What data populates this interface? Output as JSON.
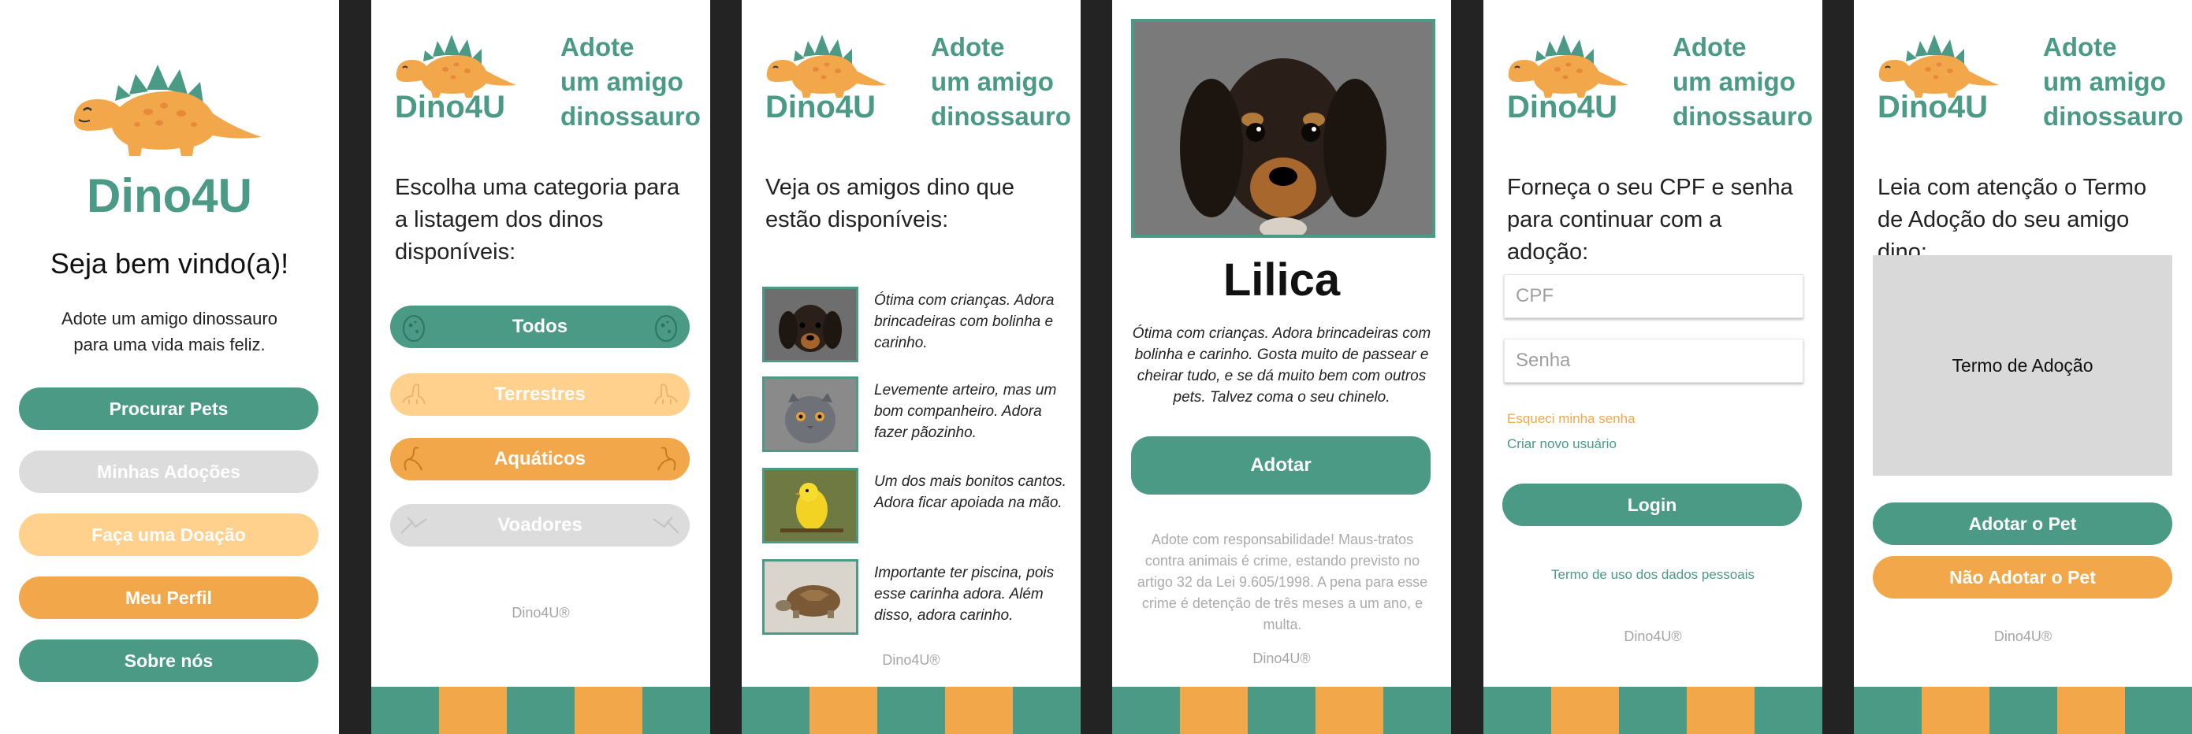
{
  "colors": {
    "green": "#4a9a86",
    "orange": "#f2a74b",
    "light_orange": "#ffd18c",
    "gray": "#dcdcdc"
  },
  "brand": "Dino4U",
  "tagline": [
    "Adote",
    "um amigo",
    "dinossauro"
  ],
  "footer": "Dino4U®",
  "welcome": {
    "heading": "Seja bem vindo(a)!",
    "subtitle": [
      "Adote um amigo dinossauro",
      "para uma vida mais feliz."
    ],
    "buttons": [
      "Procurar Pets",
      "Minhas Adoções",
      "Faça uma Doação",
      "Meu Perfil",
      "Sobre nós"
    ]
  },
  "categories": {
    "intro": "Escolha uma categoria para a listagem dos dinos disponíveis:",
    "items": [
      {
        "label": "Todos",
        "icon": "egg-icon"
      },
      {
        "label": "Terrestres",
        "icon": "dino-icon"
      },
      {
        "label": "Aquáticos",
        "icon": "sea-dino-icon"
      },
      {
        "label": "Voadores",
        "icon": "pterodactyl-icon"
      }
    ]
  },
  "listing": {
    "intro": "Veja os amigos dino que estão disponíveis:",
    "pets": [
      {
        "image": "puppy-photo",
        "desc": "Ótima com crianças. Adora brincadeiras com bolinha e carinho."
      },
      {
        "image": "cat-photo",
        "desc": "Levemente arteiro, mas um bom companheiro. Adora fazer pãozinho."
      },
      {
        "image": "canary-photo",
        "desc": "Um dos mais bonitos cantos. Adora ficar apoiada na mão."
      },
      {
        "image": "tortoise-photo",
        "desc": "Importante ter piscina, pois esse carinha adora. Além disso, adora carinho."
      }
    ]
  },
  "detail": {
    "name": "Lilica",
    "description": "Ótima com crianças. Adora brincadeiras com bolinha e carinho. Gosta muito de passear e cheirar tudo, e se dá muito bem com outros pets. Talvez coma o seu chinelo.",
    "adopt_button": "Adotar",
    "warning": "Adote com responsabilidade! Maus-tratos contra animais é crime, estando previsto no artigo 32 da Lei 9.605/1998. A pena para esse crime é detenção de três meses a um ano, e multa."
  },
  "login": {
    "intro": "Forneça o seu CPF e senha para continuar com a adoção:",
    "cpf_placeholder": "CPF",
    "password_placeholder": "Senha",
    "forgot": "Esqueci minha senha",
    "new_user": "Criar novo usuário",
    "login_button": "Login",
    "terms_link": "Termo de uso dos dados pessoais"
  },
  "terms": {
    "intro": "Leia com atenção o Termo de Adoção do seu amigo dino:",
    "box_text": "Termo de Adoção",
    "accept_button": "Adotar o Pet",
    "decline_button": "Não Adotar o Pet"
  }
}
